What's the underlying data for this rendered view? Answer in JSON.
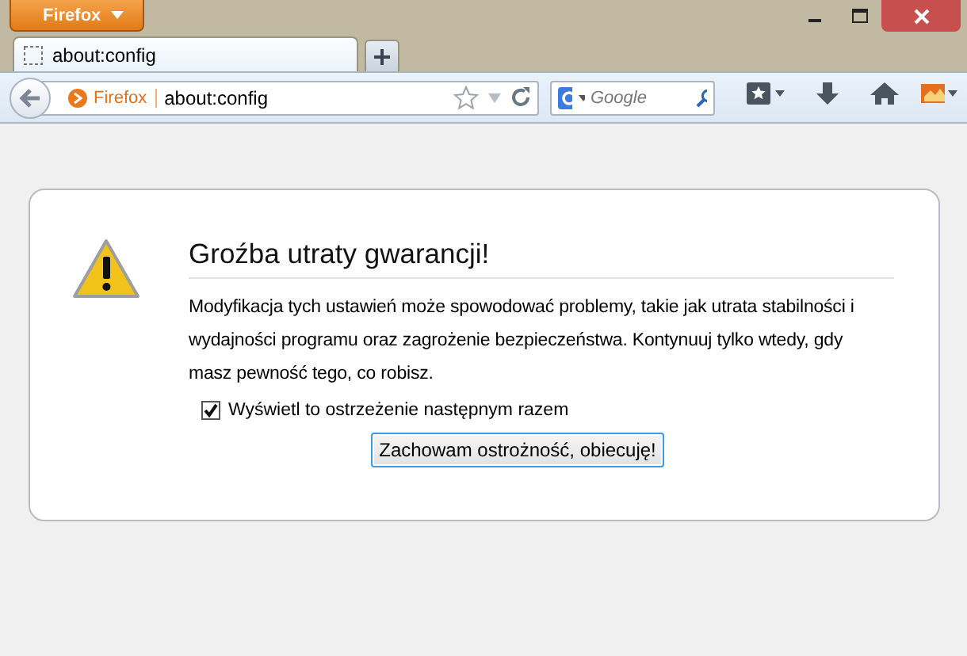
{
  "window": {
    "app_menu": "Firefox"
  },
  "tabs": [
    {
      "title": "about:config",
      "selected": true
    }
  ],
  "navbar": {
    "identity": "Firefox",
    "url": "about:config",
    "search": {
      "placeholder": "Google"
    }
  },
  "warning": {
    "title": "Groźba utraty gwarancji!",
    "message": "Modyfikacja tych ustawień może spowodować problemy, takie jak utrata stabilności i wydajności programu oraz zagrożenie bezpieczeństwa. Kontynuuj tylko wtedy, gdy masz pewność tego, co robisz.",
    "checkbox": {
      "label": "Wyświetl to ostrzeżenie następnym razem",
      "checked": true
    },
    "button": "Zachowam ostrożność, obiecuję!"
  }
}
